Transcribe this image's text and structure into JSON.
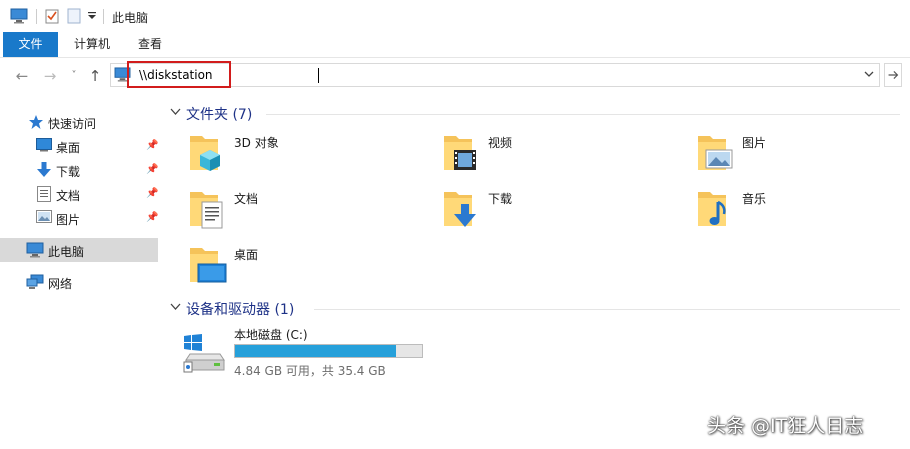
{
  "window": {
    "title": "此电脑"
  },
  "ribbon": {
    "tabs": [
      "文件",
      "计算机",
      "查看"
    ]
  },
  "address": {
    "value": "\\\\diskstation",
    "dropdown_icon": "chevron-down-icon",
    "go_icon": "arrow-right-icon"
  },
  "nav": {
    "back": "←",
    "forward": "→",
    "recent": "˅",
    "up": "↑"
  },
  "sidebar": {
    "quick_access": "快速访问",
    "pinned": [
      {
        "label": "桌面",
        "icon": "desktop-icon"
      },
      {
        "label": "下载",
        "icon": "download-icon"
      },
      {
        "label": "文档",
        "icon": "document-icon"
      },
      {
        "label": "图片",
        "icon": "picture-icon"
      }
    ],
    "this_pc": "此电脑",
    "network": "网络"
  },
  "folders_section": {
    "title": "文件夹 (7)",
    "items": [
      "3D 对象",
      "视频",
      "图片",
      "文档",
      "下载",
      "音乐",
      "桌面"
    ]
  },
  "drives_section": {
    "title": "设备和驱动器 (1)",
    "drives": [
      {
        "label": "本地磁盘 (C:)",
        "info": "4.84 GB 可用，共 35.4 GB",
        "used_fraction": 0.863
      }
    ]
  },
  "watermark": "头条 @IT狂人日志",
  "colors": {
    "accent": "#1979ca",
    "highlight": "#d21c1c",
    "drive_fill": "#26a0da",
    "section_title": "#1e3287"
  }
}
